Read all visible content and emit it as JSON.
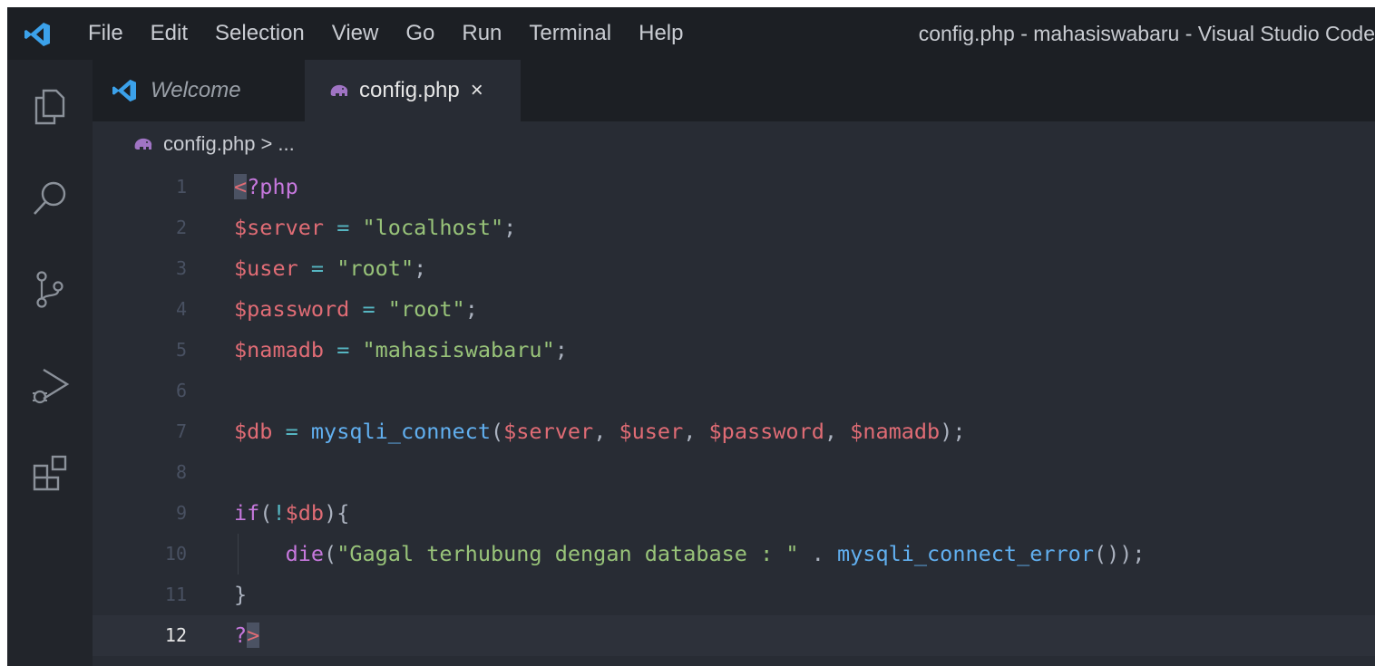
{
  "menu": [
    "File",
    "Edit",
    "Selection",
    "View",
    "Go",
    "Run",
    "Terminal",
    "Help"
  ],
  "window_title": "config.php - mahasiswabaru - Visual Studio Code",
  "tabs": [
    {
      "label": "Welcome",
      "active": false
    },
    {
      "label": "config.php",
      "active": true,
      "close": "×"
    }
  ],
  "breadcrumb": {
    "file": "config.php",
    "separator": ">",
    "rest": "..."
  },
  "activity_icons": [
    "explorer-icon",
    "search-icon",
    "source-control-icon",
    "run-debug-icon",
    "extensions-icon"
  ],
  "colors": {
    "background": "#282c34",
    "keyword": "#c678dd",
    "variable": "#e06c75",
    "string": "#98c379",
    "function": "#61afef",
    "operator": "#56b6c2"
  },
  "code_lines": [
    {
      "n": "1",
      "tokens": [
        [
          "<",
          "cursor-bg c-tagopen"
        ],
        [
          "?php",
          "c-tag"
        ]
      ]
    },
    {
      "n": "2",
      "tokens": [
        [
          "$server",
          "c-var"
        ],
        [
          " = ",
          "c-op"
        ],
        [
          "\"localhost\"",
          "c-str"
        ],
        [
          ";",
          "c-pun"
        ]
      ]
    },
    {
      "n": "3",
      "tokens": [
        [
          "$user",
          "c-var"
        ],
        [
          " = ",
          "c-op"
        ],
        [
          "\"root\"",
          "c-str"
        ],
        [
          ";",
          "c-pun"
        ]
      ]
    },
    {
      "n": "4",
      "tokens": [
        [
          "$password",
          "c-var"
        ],
        [
          " = ",
          "c-op"
        ],
        [
          "\"root\"",
          "c-str"
        ],
        [
          ";",
          "c-pun"
        ]
      ]
    },
    {
      "n": "5",
      "tokens": [
        [
          "$namadb",
          "c-var"
        ],
        [
          " = ",
          "c-op"
        ],
        [
          "\"mahasiswabaru\"",
          "c-str"
        ],
        [
          ";",
          "c-pun"
        ]
      ]
    },
    {
      "n": "6",
      "tokens": []
    },
    {
      "n": "7",
      "tokens": [
        [
          "$db",
          "c-var"
        ],
        [
          " = ",
          "c-op"
        ],
        [
          "mysqli_connect",
          "c-fn"
        ],
        [
          "(",
          "c-pun"
        ],
        [
          "$server",
          "c-var"
        ],
        [
          ", ",
          "c-pun"
        ],
        [
          "$user",
          "c-var"
        ],
        [
          ", ",
          "c-pun"
        ],
        [
          "$password",
          "c-var"
        ],
        [
          ", ",
          "c-pun"
        ],
        [
          "$namadb",
          "c-var"
        ],
        [
          ");",
          "c-pun"
        ]
      ]
    },
    {
      "n": "8",
      "tokens": []
    },
    {
      "n": "9",
      "tokens": [
        [
          "if",
          "c-kw"
        ],
        [
          "(",
          "c-pun"
        ],
        [
          "!",
          "c-op"
        ],
        [
          "$db",
          "c-var"
        ],
        [
          "){",
          "c-pun"
        ]
      ]
    },
    {
      "n": "10",
      "indent": true,
      "tokens": [
        [
          "    ",
          "c-pun"
        ],
        [
          "die",
          "c-kw"
        ],
        [
          "(",
          "c-pun"
        ],
        [
          "\"Gagal terhubung dengan database : \"",
          "c-str"
        ],
        [
          " . ",
          "c-pun"
        ],
        [
          "mysqli_connect_error",
          "c-fn"
        ],
        [
          "());",
          "c-pun"
        ]
      ]
    },
    {
      "n": "11",
      "tokens": [
        [
          "}",
          "c-pun"
        ]
      ]
    },
    {
      "n": "12",
      "active": true,
      "tokens": [
        [
          "?",
          "c-tag"
        ],
        [
          ">",
          "cursor-bg c-tagopen"
        ]
      ]
    }
  ]
}
